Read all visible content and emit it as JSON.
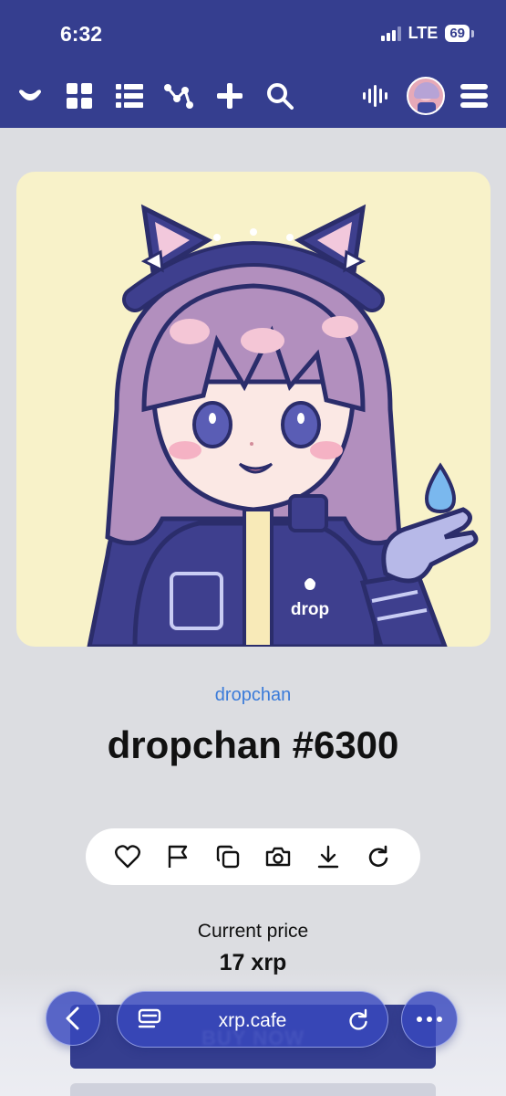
{
  "status": {
    "time": "6:32",
    "network": "LTE",
    "battery": "69"
  },
  "nav": {
    "icons": [
      "logo-icon",
      "grid-icon",
      "list-icon",
      "activity-icon",
      "plus-icon",
      "search-icon",
      "audio-icon",
      "avatar",
      "menu-icon"
    ]
  },
  "nft": {
    "collection": "dropchan",
    "title": "dropchan #6300",
    "jacket_text": "drop"
  },
  "actions": [
    "heart-icon",
    "flag-icon",
    "copy-icon",
    "camera-icon",
    "download-icon",
    "refresh-icon"
  ],
  "price": {
    "label": "Current price",
    "value": "17 xrp"
  },
  "buy": {
    "label": "BUY NOW"
  },
  "browser": {
    "url": "xrp.cafe"
  },
  "colors": {
    "header": "#353e8f",
    "link": "#3b7bd9",
    "art_bg": "#f8f2c9",
    "background": "#dcdde1"
  }
}
